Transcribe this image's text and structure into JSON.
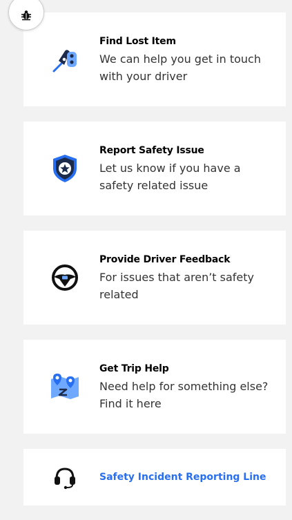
{
  "colors": {
    "accent_blue": "#276ef1",
    "light_blue": "#6ea8ff",
    "navy": "#1c2b4a",
    "card_bg": "#ffffff",
    "page_bg": "#f2f2f2"
  },
  "debug_button": {
    "icon": "bug-icon"
  },
  "cards": [
    {
      "icon": "lost-item-key-icon",
      "title": "Find Lost Item",
      "subtitle": "We can help you get in touch with your driver"
    },
    {
      "icon": "shield-star-icon",
      "title": "Report Safety Issue",
      "subtitle": "Let us know if you have a safety related issue"
    },
    {
      "icon": "steering-wheel-icon",
      "title": "Provide Driver Feedback",
      "subtitle": "For issues that aren’t safety related"
    },
    {
      "icon": "map-pins-icon",
      "title": "Get Trip Help",
      "subtitle": "Need help for something else? Find it here"
    }
  ],
  "safety_line": {
    "icon": "headset-icon",
    "label": "Safety Incident Reporting Line"
  }
}
